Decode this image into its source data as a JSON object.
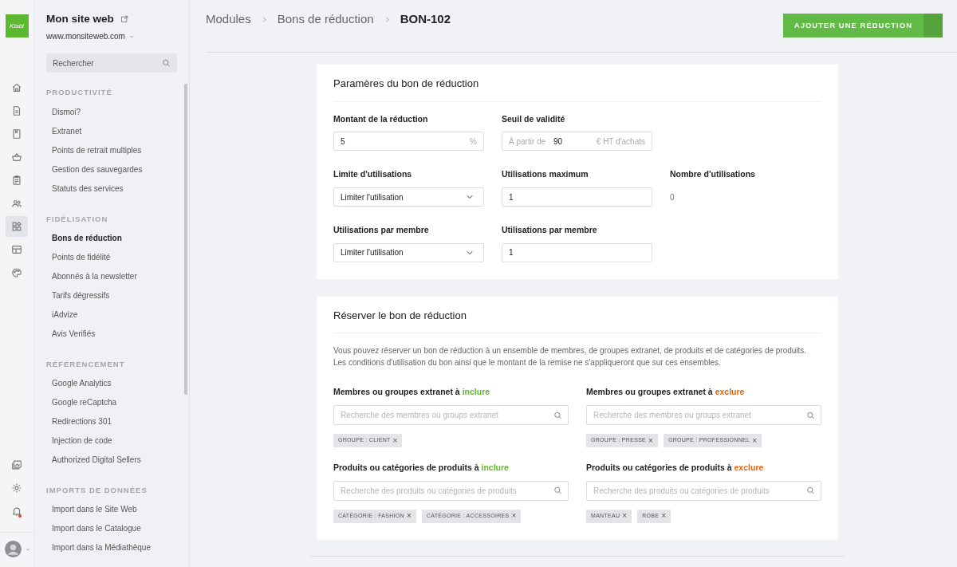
{
  "logo": {
    "text": "Kiabi"
  },
  "rail": {
    "items": [
      {
        "selected": false
      },
      {
        "selected": false
      },
      {
        "selected": false
      },
      {
        "selected": false
      },
      {
        "selected": false
      },
      {
        "selected": false
      },
      {
        "selected": true
      },
      {
        "selected": false
      },
      {
        "selected": false
      }
    ],
    "bottom": [
      {
        "notification": false
      },
      {
        "notification": false
      },
      {
        "notification": true
      }
    ]
  },
  "sidebar": {
    "site_title": "Mon site web",
    "site_url": "www.monsiteweb.com",
    "search": {
      "placeholder": "Rechercher"
    },
    "sections": [
      {
        "title": "PRODUCTIVITÉ",
        "items": [
          {
            "label": "Dismoi?",
            "selected": false
          },
          {
            "label": "Extranet",
            "selected": false
          },
          {
            "label": "Points de retrait multiples",
            "selected": false
          },
          {
            "label": "Gestion des sauvegardes",
            "selected": false
          },
          {
            "label": "Statuts des services",
            "selected": false
          }
        ]
      },
      {
        "title": "FIDÉLISATION",
        "items": [
          {
            "label": "Bons de réduction",
            "selected": true
          },
          {
            "label": "Points de fidélité",
            "selected": false
          },
          {
            "label": "Abonnés à la newsletter",
            "selected": false
          },
          {
            "label": "Tarifs dégressifs",
            "selected": false
          },
          {
            "label": "iAdvize",
            "selected": false
          },
          {
            "label": "Avis Verifiés",
            "selected": false
          }
        ]
      },
      {
        "title": "RÉFÉRENCEMENT",
        "items": [
          {
            "label": "Google Analytics",
            "selected": false
          },
          {
            "label": "Google reCaptcha",
            "selected": false
          },
          {
            "label": "Redirections 301",
            "selected": false
          },
          {
            "label": "Injection de code",
            "selected": false
          },
          {
            "label": "Authorized Digital Sellers",
            "selected": false
          }
        ]
      },
      {
        "title": "IMPORTS DE DONNÉES",
        "items": [
          {
            "label": "Import dans le Site Web",
            "selected": false
          },
          {
            "label": "Import dans le Catalogue",
            "selected": false
          },
          {
            "label": "Import dans la Médiathèque",
            "selected": false
          }
        ]
      }
    ]
  },
  "breadcrumb": [
    "Modules",
    "Bons de réduction",
    "BON-102"
  ],
  "primary_button": {
    "label": "AJOUTER UNE RÉDUCTION"
  },
  "settings": {
    "title": "Paramères du bon de réduction",
    "rows": [
      [
        {
          "kind": "input",
          "label": "Montant de la réduction",
          "value": "5",
          "suffix": "%"
        },
        {
          "kind": "input",
          "label": "Seuil de validité",
          "prefix": "À partir de",
          "value": "90",
          "suffix": "€ HT d'achats"
        }
      ],
      [
        {
          "kind": "select",
          "label": "Limite d'utilisations",
          "value": "Limiter l'utilisation"
        },
        {
          "kind": "input",
          "label": "Utilisations maximum",
          "value": "1"
        },
        {
          "kind": "static",
          "label": "Nombre d'utilisations",
          "value": "0"
        }
      ],
      [
        {
          "kind": "select",
          "label": "Utilisations par membre",
          "value": "Limiter l'utilisation"
        },
        {
          "kind": "input",
          "label": "Utilisations par membre",
          "value": "1"
        }
      ]
    ]
  },
  "reserve": {
    "title": "Réserver le bon de réduction",
    "description": "Vous pouvez réserver un bon de réduction à un ensemble de membres, de groupes extranet, de produits et de catégories de produits. Les conditions d'utilisation du bon ainsi que le montant de la remise ne s'appliqueront que sur ces ensembles.",
    "groups": [
      {
        "label": "Membres ou groupes extranet à",
        "keyword": "inclure",
        "color": "#5cb82e",
        "placeholder": "Recherche des membres ou groups extranet",
        "tags": [
          {
            "text": "GROUPE : CLIENT",
            "remove": "×"
          }
        ]
      },
      {
        "label": "Membres ou groupes extranet à",
        "keyword": "exclure",
        "color": "#e8650f",
        "placeholder": "Recherche des membres ou groups extranet",
        "tags": [
          {
            "text": "GROUPE : PRESSE",
            "remove": "×"
          },
          {
            "text": "GROUPE : PROFESSIONNEL",
            "remove": "×"
          }
        ]
      },
      {
        "label": "Produits ou catégories de produits à",
        "keyword": "inclure",
        "color": "#5cb82e",
        "placeholder": "Recherche des produits ou catégories de produits",
        "tags": [
          {
            "text": "CATÉGORIE : FASHION",
            "remove": "×"
          },
          {
            "text": "CATÉGORIE : ACCESSOIRES",
            "remove": "×"
          }
        ]
      },
      {
        "label": "Produits ou catégories de produits à",
        "keyword": "exclure",
        "color": "#e8650f",
        "placeholder": "Recherche des produits ou catégories de produits",
        "tags": [
          {
            "text": "MANTEAU",
            "remove": "×"
          },
          {
            "text": "ROBE",
            "remove": "×"
          }
        ]
      }
    ]
  }
}
